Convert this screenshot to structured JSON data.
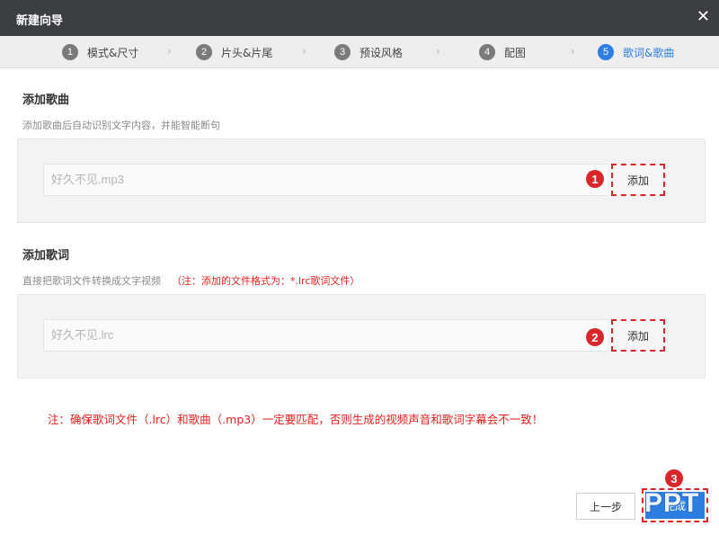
{
  "window": {
    "title": "新建向导",
    "close_glyph": "✕"
  },
  "steps": [
    {
      "num": "1",
      "label": "模式&尺寸"
    },
    {
      "num": "2",
      "label": "片头&片尾"
    },
    {
      "num": "3",
      "label": "预设风格"
    },
    {
      "num": "4",
      "label": "配图"
    },
    {
      "num": "5",
      "label": "歌词&歌曲"
    }
  ],
  "active_step": 5,
  "song": {
    "title": "添加歌曲",
    "desc": "添加歌曲后自动识别文字内容，并能智能断句",
    "input_value": "好久不见.mp3",
    "add_label": "添加",
    "marker": "1"
  },
  "lyrics": {
    "title": "添加歌词",
    "desc": "直接把歌词文件转换成文字视频",
    "note": "（注：添加的文件格式为：*.lrc歌词文件）",
    "input_value": "好久不见.lrc",
    "add_label": "添加",
    "marker": "2"
  },
  "warning": "注：确保歌词文件（.lrc）和歌曲（.mp3）一定要匹配，否则生成的视频声音和歌词字幕会不一致！",
  "footer": {
    "prev_label": "上一步",
    "finish_label": "完成",
    "marker": "3",
    "watermark": "PPT"
  },
  "colors": {
    "accent": "#2d7ee2",
    "highlight": "#d8262a",
    "titlebar": "#3b3e43"
  }
}
